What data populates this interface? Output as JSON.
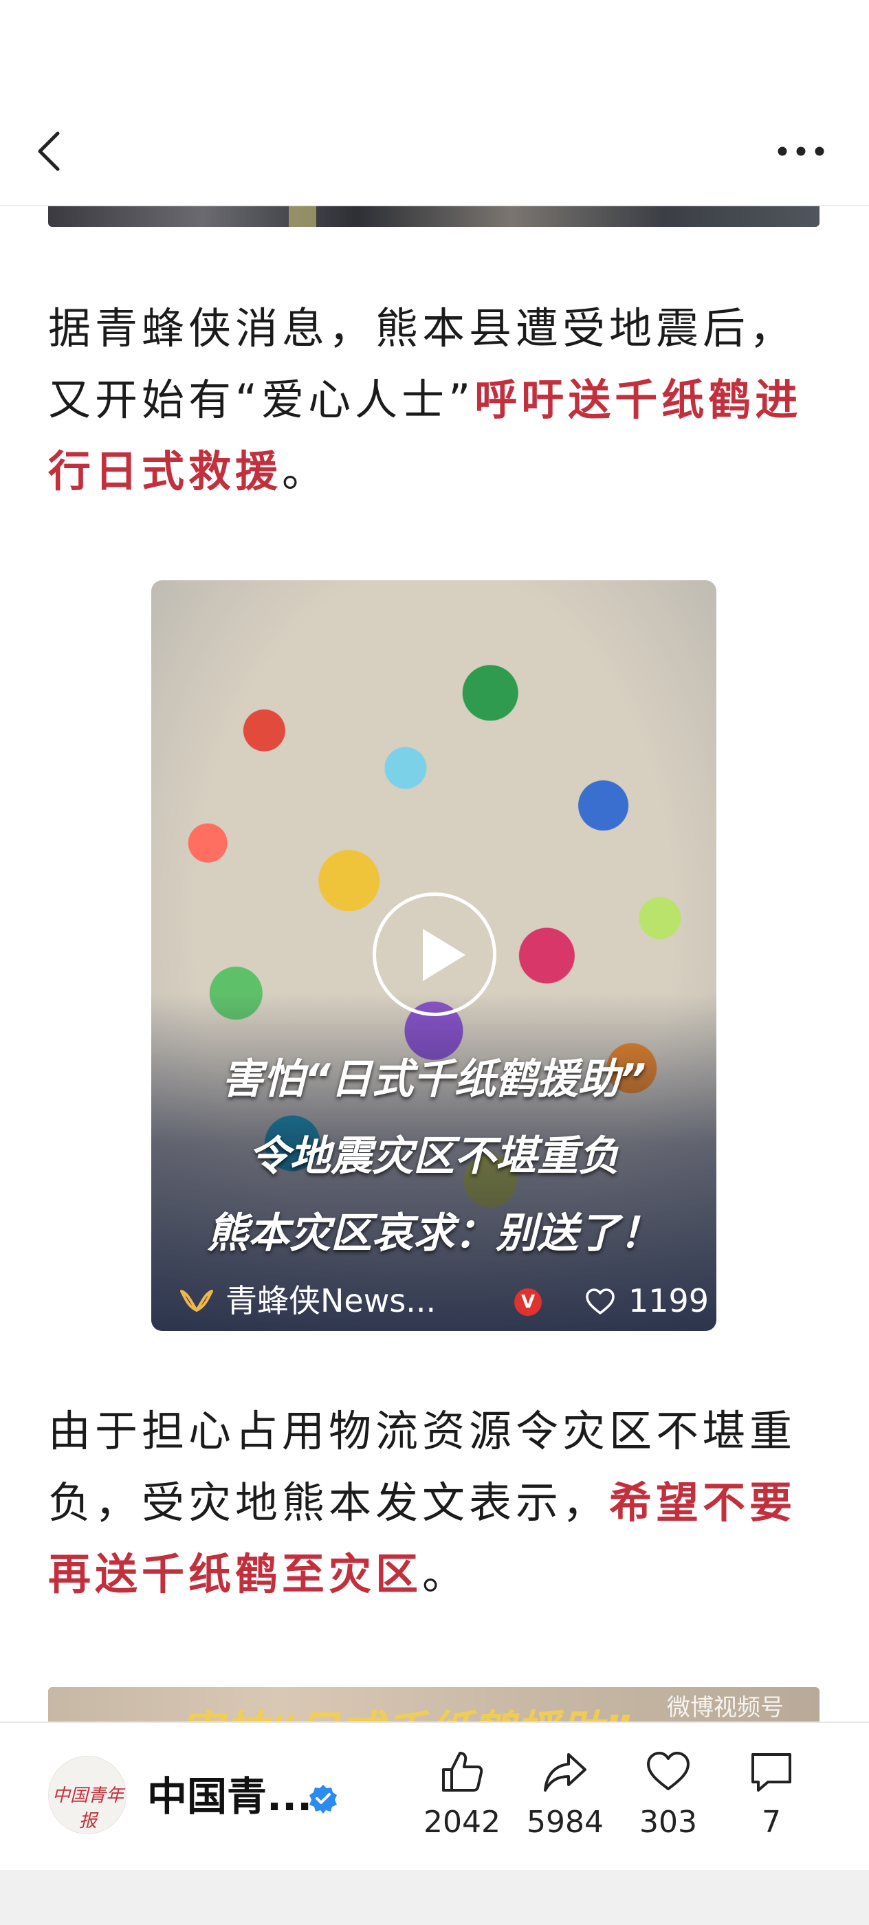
{
  "nav": {
    "back_icon": "chevron-left-icon",
    "more_icon": "more-horizontal-icon"
  },
  "article": {
    "para1": {
      "text": "据青蜂侠消息，熊本县遭受地震后，又开始有“爱心人士”",
      "highlight": "呼吁送千纸鹤进行日式救援",
      "end": "。"
    },
    "video": {
      "caption_lines": [
        "害怕“日式千纸鹤援助”",
        "令地震灾区不堪重负",
        "熊本灾区哀求：别送了！"
      ],
      "channel_name": "青蜂侠News...",
      "verified_badge": "V",
      "like_count": "1199"
    },
    "para2": {
      "text": "由于担心占用物流资源令灾区不堪重负，受灾地熊本发文表示，",
      "highlight": "希望不要再送千纸鹤至灾区",
      "end": "。"
    },
    "next_image": {
      "watermark": "微博视频号",
      "partial_caption": "害怕“日式千纸鹤援助”"
    }
  },
  "bottom_bar": {
    "avatar_text": "中国青年报",
    "account_name": "中国青...",
    "like_count": "2042",
    "share_count": "5984",
    "favorite_count": "303",
    "comment_count": "7"
  },
  "colors": {
    "highlight": "#c3303d",
    "verified": "#2a8cf0",
    "badge": "#e0322e"
  }
}
